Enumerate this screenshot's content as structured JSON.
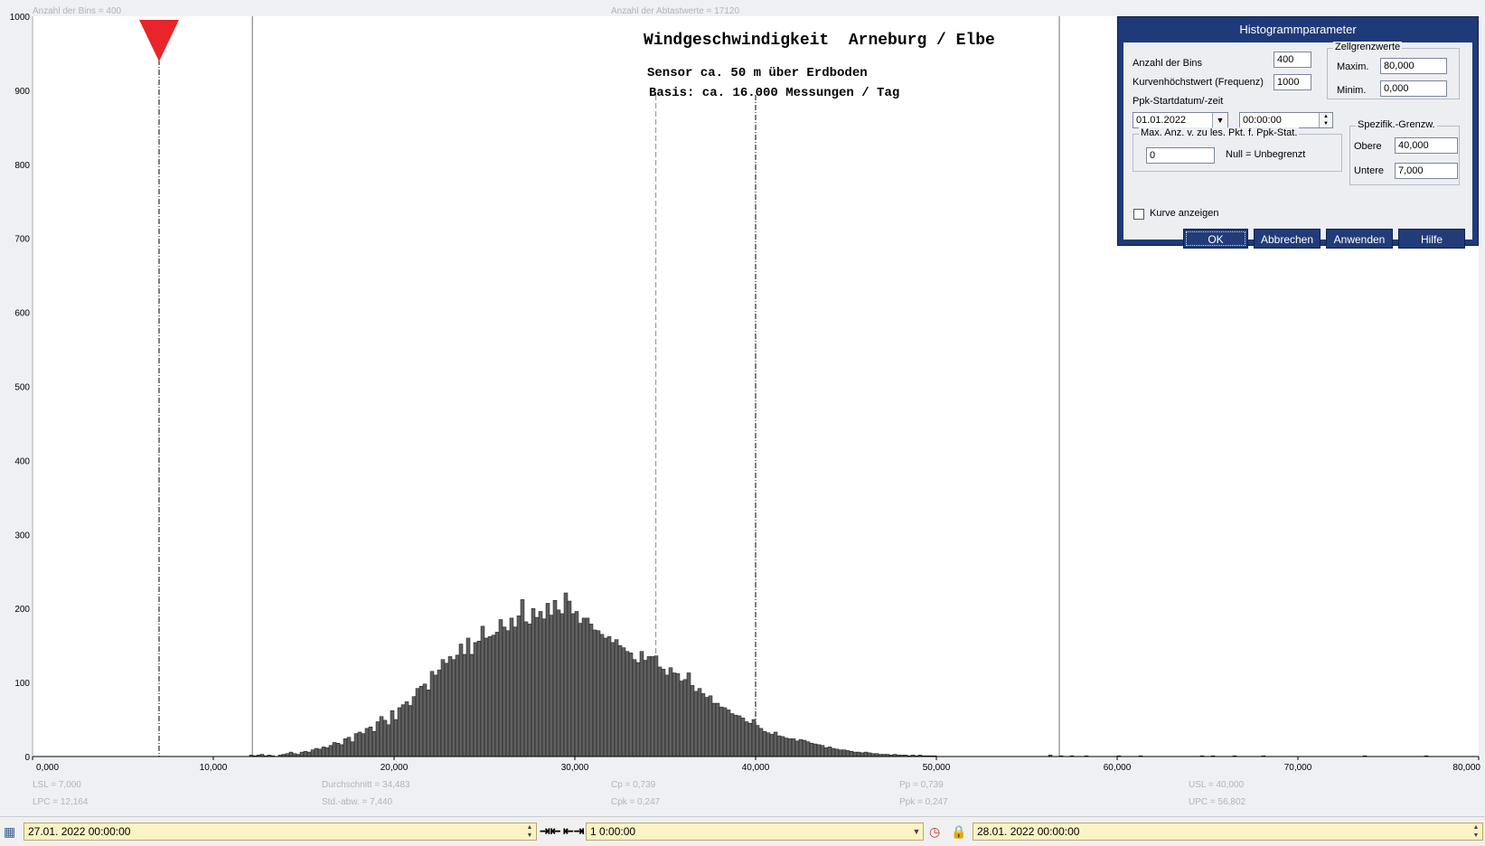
{
  "header": {
    "bins_label": "Anzahl der Bins =   400",
    "samples_label": "Anzahl der Abtastwerte = 17120"
  },
  "chart_data": {
    "type": "bar",
    "title": "Windgeschwindigkeit  Arneburg / Elbe",
    "subtitle1": "Sensor ca. 50 m über Erdboden",
    "subtitle2": "Basis: ca. 16.000 Messungen / Tag",
    "xlim": [
      0,
      80
    ],
    "ylim": [
      0,
      1000
    ],
    "bin_width": 0.2,
    "bar_start": 12.0,
    "x_ticks": [
      "0,000",
      "10,000",
      "20,000",
      "30,000",
      "40,000",
      "50,000",
      "60,000",
      "70,000",
      "80,000"
    ],
    "y_ticks": [
      "0",
      "100",
      "200",
      "300",
      "400",
      "500",
      "600",
      "700",
      "800",
      "900",
      "1000"
    ],
    "values": [
      2,
      1,
      2,
      3,
      1,
      2,
      1,
      0,
      2,
      3,
      4,
      6,
      4,
      3,
      6,
      7,
      6,
      9,
      11,
      10,
      13,
      12,
      15,
      19,
      18,
      16,
      24,
      26,
      20,
      31,
      33,
      31,
      38,
      40,
      34,
      47,
      54,
      49,
      43,
      62,
      50,
      66,
      70,
      74,
      69,
      81,
      92,
      95,
      98,
      90,
      115,
      110,
      117,
      131,
      126,
      135,
      131,
      137,
      152,
      138,
      160,
      138,
      154,
      156,
      176,
      160,
      162,
      164,
      168,
      185,
      175,
      170,
      187,
      175,
      190,
      212,
      182,
      179,
      200,
      188,
      196,
      186,
      207,
      191,
      211,
      198,
      193,
      221,
      210,
      193,
      196,
      180,
      187,
      187,
      179,
      171,
      170,
      165,
      160,
      162,
      154,
      158,
      150,
      147,
      142,
      140,
      131,
      127,
      142,
      130,
      135,
      135,
      136,
      121,
      118,
      110,
      120,
      113,
      112,
      102,
      104,
      113,
      96,
      88,
      92,
      85,
      80,
      82,
      72,
      72,
      67,
      66,
      63,
      58,
      56,
      55,
      52,
      47,
      45,
      50,
      42,
      38,
      34,
      32,
      30,
      33,
      28,
      27,
      25,
      24,
      24,
      21,
      23,
      22,
      20,
      18,
      17,
      16,
      15,
      12,
      13,
      11,
      10,
      9,
      9,
      8,
      7,
      6,
      6,
      5,
      6,
      5,
      4,
      4,
      3,
      3,
      3,
      2,
      3,
      2,
      2,
      2,
      1,
      2,
      1,
      2,
      1,
      1,
      1,
      1
    ],
    "sparse_tail": [
      [
        56.2,
        2
      ],
      [
        56.8,
        1
      ],
      [
        57.4,
        1
      ],
      [
        58.2,
        1
      ],
      [
        60.0,
        1
      ],
      [
        61.2,
        1
      ],
      [
        64.6,
        1
      ],
      [
        65.2,
        1
      ],
      [
        66.4,
        1
      ],
      [
        68.0,
        1
      ],
      [
        73.6,
        1
      ],
      [
        77.0,
        1
      ]
    ],
    "lsl": 7.0,
    "usl": 40.0,
    "lpc": 12.164,
    "upc": 56.802,
    "mean": 34.483,
    "marker_lines": [
      34.483,
      40.0
    ],
    "stats": {
      "lsl": "LSL = 7,000",
      "lpc": "LPC = 12,164",
      "mean": "Durchschnitt  = 34,483",
      "std": "Std.-abw. = 7,440",
      "cp": "Cp  = 0,739",
      "cpk": "Cpk = 0,247",
      "pp": "Pp  = 0,739",
      "ppk": "Ppk = 0,247",
      "usl": "USL = 40,000",
      "upc": "UPC = 56,802"
    },
    "colors": {
      "bar": "#606060",
      "marker": "#e8252a"
    }
  },
  "dialog": {
    "title": "Histogrammparameter",
    "bins_label": "Anzahl der Bins",
    "bins_value": "400",
    "curve_max_label": "Kurvenhöchstwert (Frequenz)",
    "curve_max_value": "1000",
    "ppk_start_label": "Ppk-Startdatum/-zeit",
    "ppk_date": "01.01.2022",
    "ppk_time": "00:00:00",
    "cell_limits_title": "Zellgrenzwerte",
    "max_label": "Maxim.",
    "max_value": "80,000",
    "min_label": "Minim.",
    "min_value": "0,000",
    "maxcount_title": "Max. Anz. v. zu les. Pkt. f. Ppk-Stat.",
    "maxcount_value": "0",
    "maxcount_note": "Null = Unbegrenzt",
    "spec_title": "Spezifik.-Grenzw.",
    "upper_label": "Obere",
    "upper_value": "40,000",
    "lower_label": "Untere",
    "lower_value": "7,000",
    "show_curve_label": "Kurve anzeigen",
    "ok": "OK",
    "cancel": "Abbrechen",
    "apply": "Anwenden",
    "help": "Hilfe"
  },
  "footer": {
    "start": "27.01. 2022   00:00:00",
    "span": "1 0:00:00",
    "end": "28.01. 2022   00:00:00"
  }
}
